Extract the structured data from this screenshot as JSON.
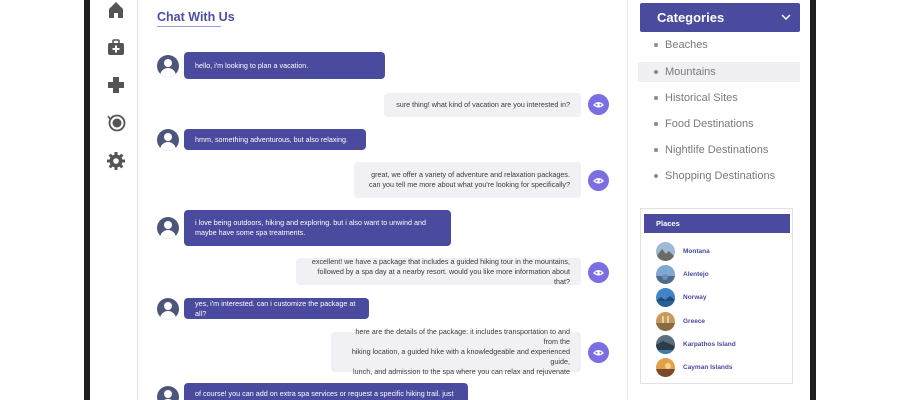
{
  "nav": {
    "items": [
      {
        "name": "home-icon"
      },
      {
        "name": "medical-bag-icon"
      },
      {
        "name": "plus-icon"
      },
      {
        "name": "history-icon"
      },
      {
        "name": "settings-gear-icon"
      }
    ]
  },
  "chat": {
    "title": "Chat With Us",
    "messages": [
      {
        "from": "user",
        "text": "hello, i'm looking to plan a vacation."
      },
      {
        "from": "bot",
        "text": "sure thing! what kind of vacation are you interested in?"
      },
      {
        "from": "user",
        "text": "hmm, something adventurous, but also relaxing."
      },
      {
        "from": "bot",
        "text": "great, we offer a variety of adventure and relaxation packages.\ncan you tell me more about what you're looking for specifically?"
      },
      {
        "from": "user",
        "text": "i love being outdoors, hiking and exploring. but i also want to unwind and\nmaybe have some spa treatments."
      },
      {
        "from": "bot",
        "text": "excellent! we have a package that includes a guided hiking tour in the mountains,\nfollowed by a spa day at a nearby resort. would you like more information about that?"
      },
      {
        "from": "user",
        "text": "yes, i'm interested. can i customize the package at all?"
      },
      {
        "from": "bot",
        "text": "here are the details of the package: it includes transportation to and from the\nhiking location, a guided hike with a knowledgeable and experienced guide,\nlunch, and admission to the spa where you can relax and rejuvenate"
      },
      {
        "from": "user",
        "text": "of course! you can add on extra spa services or request a specific hiking trail. just"
      }
    ]
  },
  "categories": {
    "title": "Categories",
    "items": [
      {
        "label": "Beaches",
        "active": false
      },
      {
        "label": "Mountains",
        "active": true
      },
      {
        "label": "Historical Sites",
        "active": false
      },
      {
        "label": "Food Destinations",
        "active": false
      },
      {
        "label": "Nightlife Destinations",
        "active": false
      },
      {
        "label": "Shopping Destinations",
        "active": false
      }
    ]
  },
  "places": {
    "title": "Places",
    "items": [
      {
        "label": "Montana"
      },
      {
        "label": "Alentejo"
      },
      {
        "label": "Norway"
      },
      {
        "label": "Greece"
      },
      {
        "label": "Karpathos Island"
      },
      {
        "label": "Cayman Islands"
      }
    ]
  },
  "colors": {
    "accent": "#4a4a9e",
    "bot_icon": "#7a6ee2",
    "bot_bubble": "#f1f0f5"
  }
}
